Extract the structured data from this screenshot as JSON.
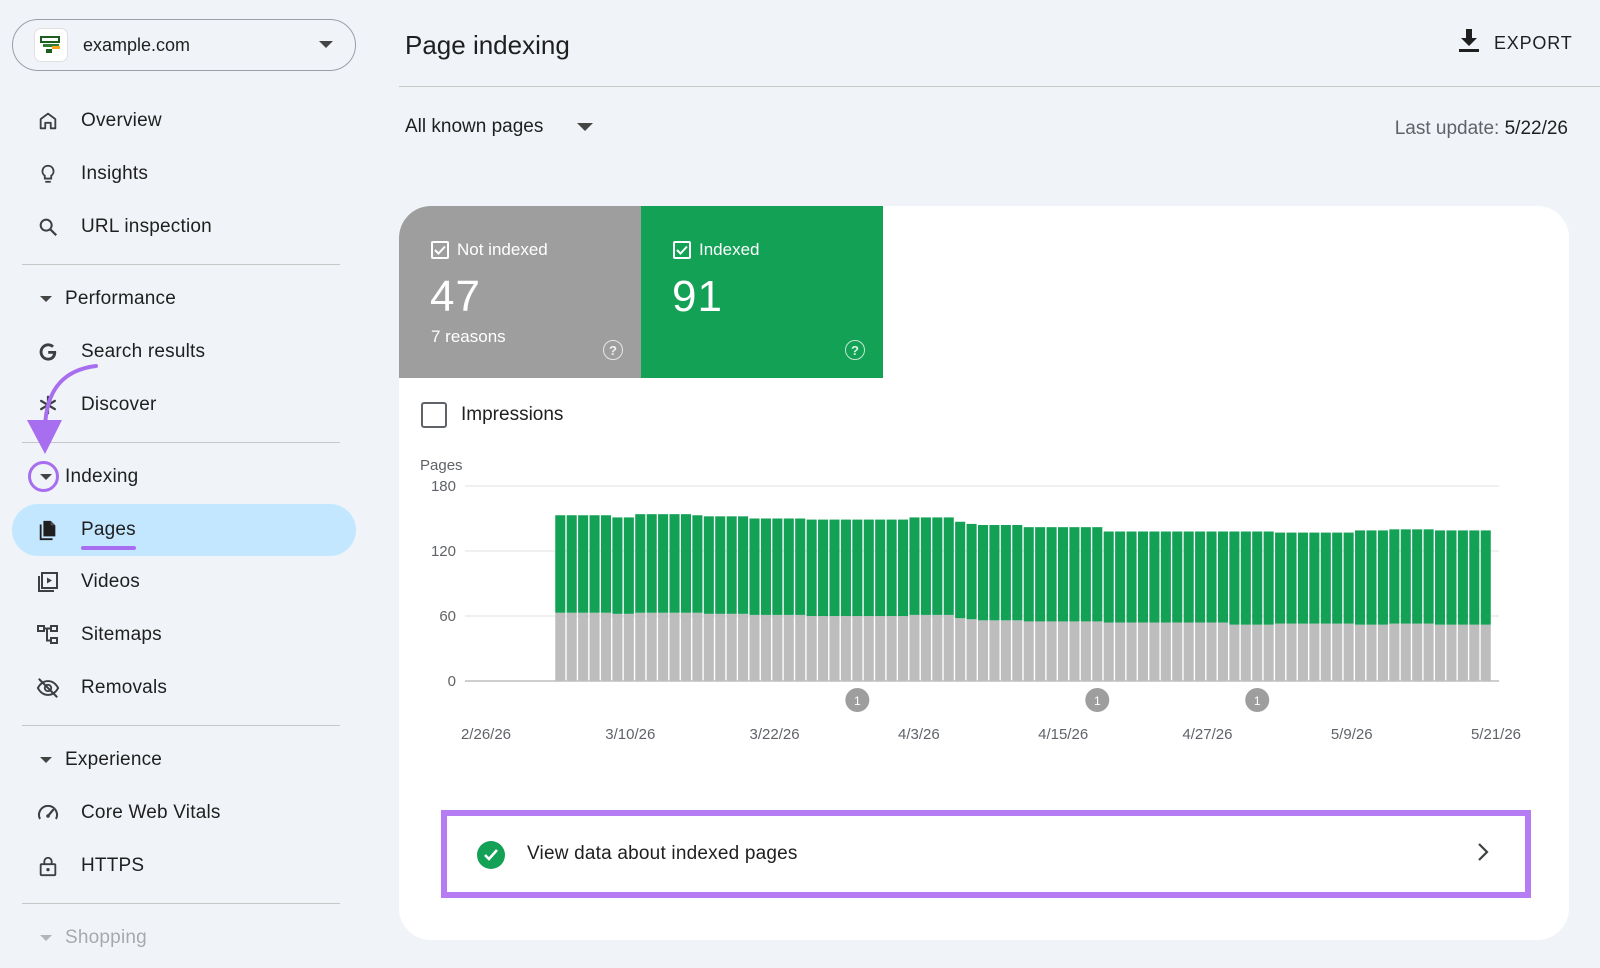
{
  "sidebar": {
    "property": "example.com",
    "items": {
      "overview": "Overview",
      "insights": "Insights",
      "url_inspection": "URL inspection",
      "search_results": "Search results",
      "discover": "Discover",
      "pages": "Pages",
      "videos": "Videos",
      "sitemaps": "Sitemaps",
      "removals": "Removals",
      "core_web_vitals": "Core Web Vitals",
      "https": "HTTPS"
    },
    "sections": {
      "performance": "Performance",
      "indexing": "Indexing",
      "experience": "Experience",
      "shopping": "Shopping"
    }
  },
  "header": {
    "title": "Page indexing",
    "export_label": "EXPORT"
  },
  "filter": {
    "selected": "All known pages"
  },
  "last_update": {
    "label": "Last update:",
    "value": "5/22/26"
  },
  "tiles": {
    "not_indexed": {
      "label": "Not indexed",
      "value": "47",
      "sub": "7 reasons"
    },
    "indexed": {
      "label": "Indexed",
      "value": "91"
    }
  },
  "impressions_label": "Impressions",
  "cta_label": "View data about indexed pages",
  "colors": {
    "indexed": "#12a155",
    "not_indexed": "#bdbdbd",
    "accent": "#a86ef0",
    "active_nav": "#c2e7ff"
  },
  "chart_data": {
    "type": "bar",
    "stacked": true,
    "ylabel": "Pages",
    "ylim": [
      0,
      180
    ],
    "yticks": [
      0,
      60,
      120,
      180
    ],
    "x_tick_labels": [
      "2/26/26",
      "3/10/26",
      "3/22/26",
      "4/3/26",
      "4/15/26",
      "4/27/26",
      "5/9/26",
      "5/21/26"
    ],
    "empty_leading_days": 7,
    "series": [
      {
        "name": "Not indexed",
        "color": "#bdbdbd",
        "values": [
          63,
          63,
          63,
          63,
          63,
          62,
          62,
          63,
          63,
          63,
          63,
          63,
          63,
          62,
          62,
          62,
          62,
          61,
          61,
          61,
          61,
          61,
          60,
          60,
          60,
          60,
          60,
          60,
          60,
          60,
          60,
          61,
          61,
          61,
          61,
          58,
          57,
          56,
          56,
          56,
          56,
          55,
          55,
          55,
          55,
          55,
          55,
          55,
          54,
          54,
          54,
          54,
          54,
          54,
          54,
          54,
          54,
          54,
          54,
          52,
          52,
          52,
          52,
          53,
          53,
          53,
          53,
          53,
          53,
          53,
          52,
          52,
          52,
          53,
          53,
          53,
          53,
          52,
          52,
          52,
          52,
          52
        ]
      },
      {
        "name": "Indexed",
        "color": "#12a155",
        "values": [
          90,
          90,
          90,
          90,
          90,
          89,
          89,
          91,
          91,
          91,
          91,
          91,
          90,
          90,
          90,
          90,
          90,
          89,
          89,
          89,
          89,
          89,
          89,
          89,
          89,
          89,
          89,
          89,
          89,
          89,
          89,
          90,
          90,
          90,
          90,
          89,
          88,
          88,
          88,
          88,
          88,
          87,
          87,
          87,
          87,
          87,
          87,
          87,
          84,
          84,
          84,
          84,
          84,
          84,
          84,
          84,
          84,
          84,
          84,
          86,
          86,
          86,
          86,
          84,
          84,
          84,
          84,
          84,
          84,
          84,
          87,
          87,
          87,
          87,
          87,
          87,
          87,
          87,
          87,
          87,
          87,
          87
        ]
      }
    ],
    "annotations": [
      {
        "x": "3/31/26",
        "label": "1"
      },
      {
        "x": "4/21/26",
        "label": "1"
      },
      {
        "x": "5/5/26",
        "label": "1"
      }
    ]
  }
}
